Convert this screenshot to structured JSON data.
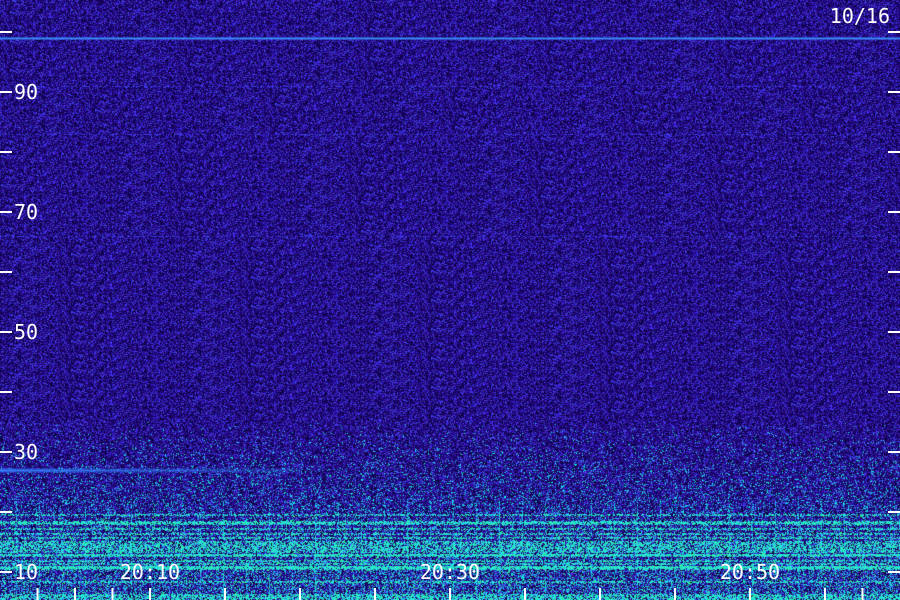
{
  "chart_data": {
    "type": "heatmap",
    "date_label": "10/16",
    "y_axis": {
      "range": [
        5,
        100
      ],
      "major_ticks": [
        10,
        20,
        30,
        40,
        50,
        60,
        70,
        80,
        90,
        100
      ],
      "tick_labels": [
        "10",
        "30",
        "50",
        "70",
        "90"
      ]
    },
    "x_axis": {
      "range": [
        "20:00",
        "21:00"
      ],
      "tick_times": [
        "20:02:30",
        "20:05",
        "20:07:30",
        "20:10",
        "20:15",
        "20:20",
        "20:25",
        "20:30",
        "20:35",
        "20:40",
        "20:45",
        "20:50",
        "20:55",
        "20:57:30"
      ],
      "tick_labels": [
        "20:10",
        "20:30",
        "20:50"
      ]
    },
    "bands": [
      {
        "y": 99,
        "note": "strong constant line"
      },
      {
        "y": 27,
        "time_end": "20:20",
        "note": "weaker line, early half"
      }
    ],
    "grid": false
  },
  "colors": {
    "background": "#1a0060",
    "noise_hi": "#3a2ad8",
    "cyan": "#00e5d4",
    "green": "#2dff6a",
    "line_blue": "#3a7dff",
    "tick": "#ffffff"
  }
}
